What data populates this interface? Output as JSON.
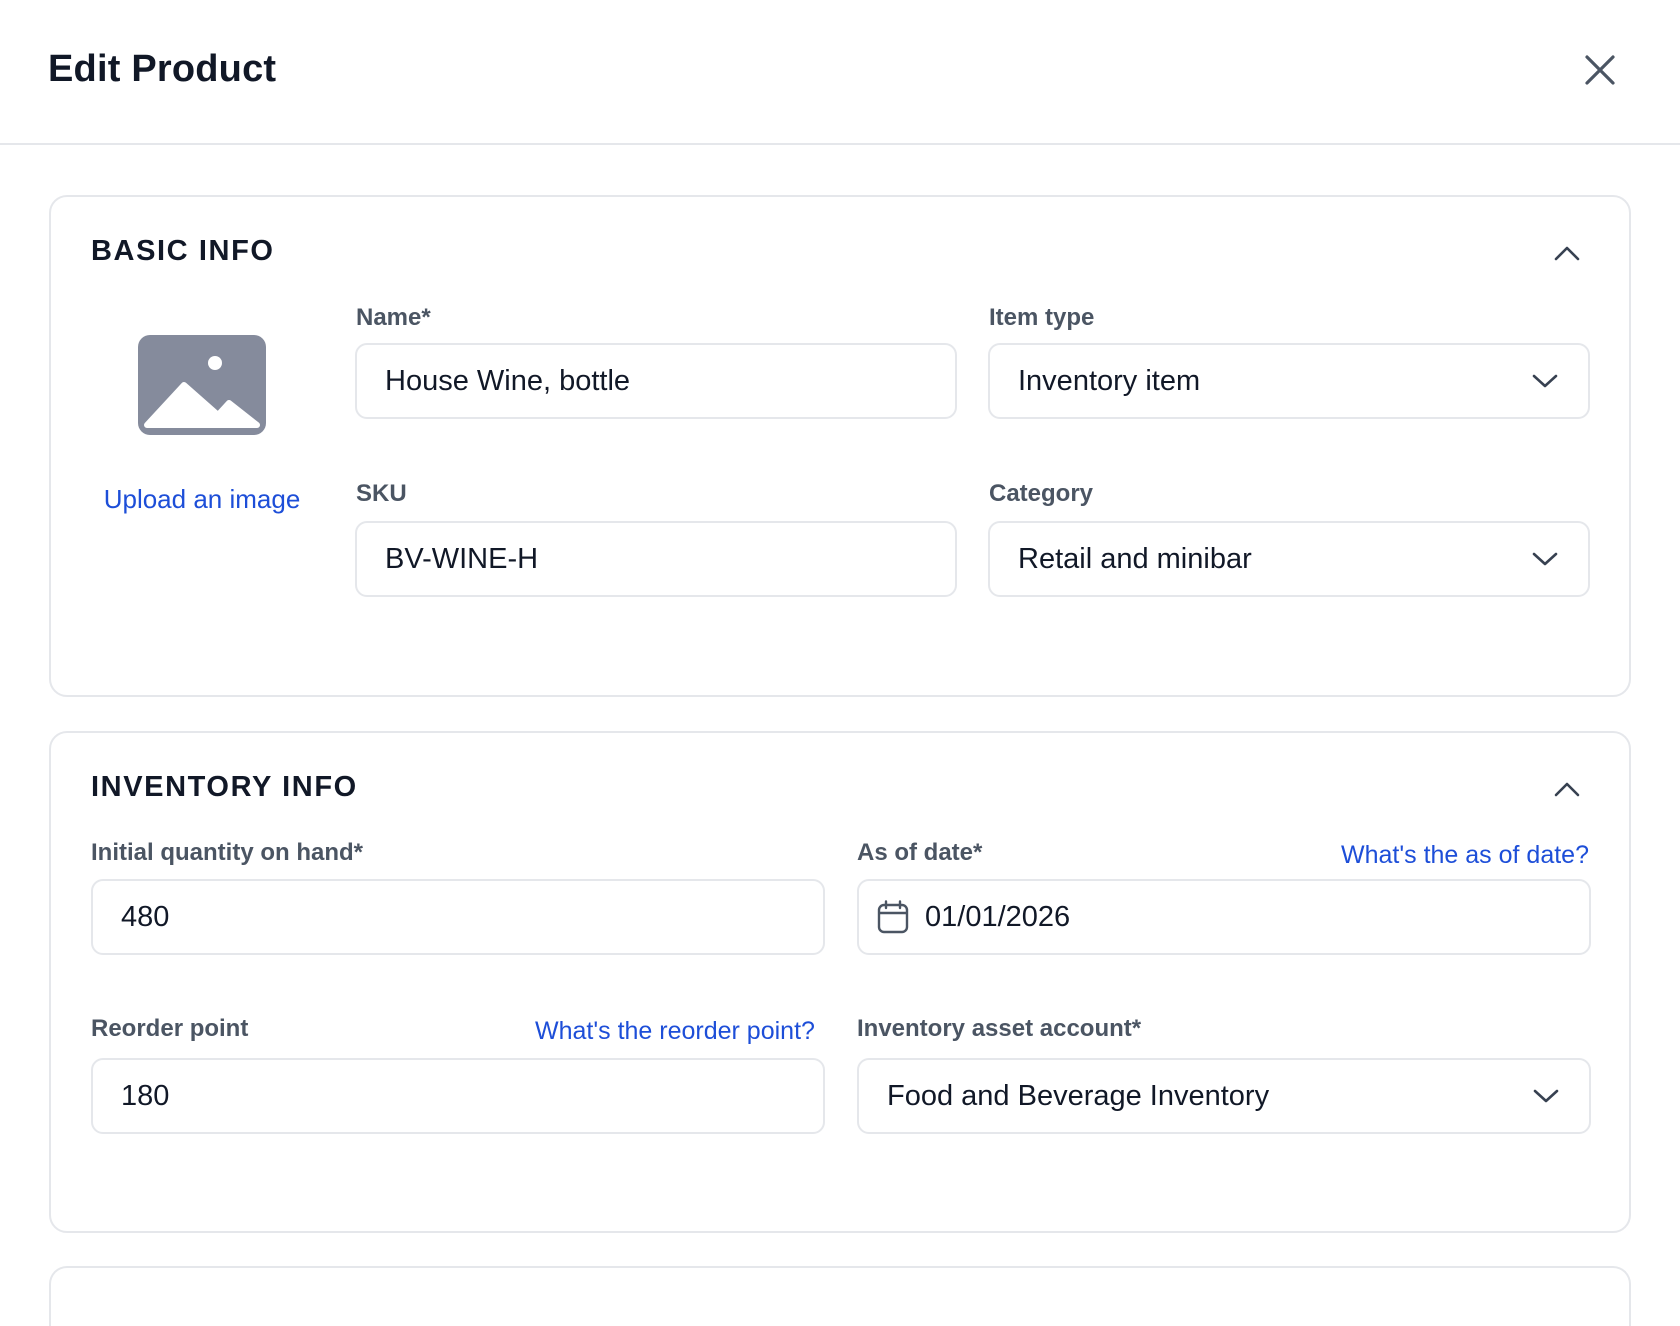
{
  "header": {
    "title": "Edit Product"
  },
  "basic_info": {
    "title": "BASIC INFO",
    "upload_label": "Upload an image",
    "name": {
      "label": "Name*",
      "value": "House Wine, bottle"
    },
    "item_type": {
      "label": "Item type",
      "value": "Inventory item"
    },
    "sku": {
      "label": "SKU",
      "value": "BV-WINE-H"
    },
    "category": {
      "label": "Category",
      "value": "Retail and minibar"
    }
  },
  "inventory_info": {
    "title": "INVENTORY INFO",
    "initial_quantity": {
      "label": "Initial quantity on hand*",
      "value": "480"
    },
    "as_of_date": {
      "label": "As of date*",
      "help": "What's the as of date?",
      "value": "01/01/2026"
    },
    "reorder_point": {
      "label": "Reorder point",
      "help": "What's the reorder point?",
      "value": "180"
    },
    "asset_account": {
      "label": "Inventory asset account*",
      "value": "Food and Beverage Inventory"
    }
  },
  "icons": {
    "close": "close-icon",
    "collapse": "chevron-up-icon",
    "dropdown": "chevron-down-icon",
    "calendar": "calendar-icon",
    "image": "image-placeholder-icon"
  },
  "colors": {
    "link": "#1d4ed8",
    "border": "#e5e7eb",
    "label": "#4b5563",
    "placeholder_icon": "#858b9c"
  }
}
